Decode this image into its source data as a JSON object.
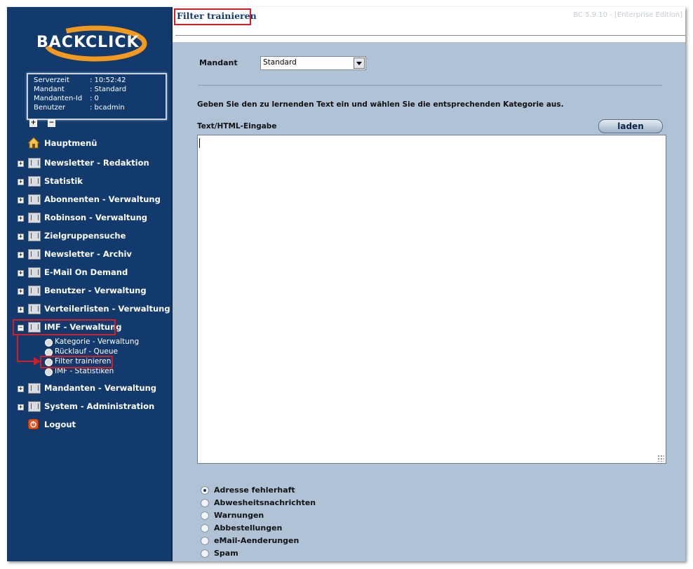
{
  "brand": {
    "logo_text": "BACKCLICK"
  },
  "server_info": [
    {
      "key": "Serverzeit",
      "value": ": 10:52:42"
    },
    {
      "key": "Mandant",
      "value": ": Standard"
    },
    {
      "key": "Mandanten-Id",
      "value": ": 0"
    },
    {
      "key": "Benutzer",
      "value": ": bcadmin"
    }
  ],
  "tree_controls": {
    "expand_all": "+",
    "collapse_all": "−"
  },
  "nav": {
    "items": [
      {
        "label": "Hauptmenü"
      },
      {
        "label": "Newsletter - Redaktion"
      },
      {
        "label": "Statistik"
      },
      {
        "label": "Abonnenten - Verwaltung"
      },
      {
        "label": "Robinson - Verwaltung"
      },
      {
        "label": "Zielgruppensuche"
      },
      {
        "label": "Newsletter - Archiv"
      },
      {
        "label": "E-Mail On Demand"
      },
      {
        "label": "Benutzer - Verwaltung"
      },
      {
        "label": "Verteilerlisten - Verwaltung"
      },
      {
        "label": "IMF - Verwaltung"
      },
      {
        "label": "Mandanten - Verwaltung"
      },
      {
        "label": "System - Administration"
      },
      {
        "label": "Logout"
      }
    ],
    "imf_sub": [
      {
        "label": "Kategorie - Verwaltung"
      },
      {
        "label": "Rücklauf - Queue"
      },
      {
        "label": "Filter trainieren"
      },
      {
        "label": "IMF - Statistiken"
      }
    ]
  },
  "header": {
    "page_title": "Filter trainieren",
    "version": "BC 5.9.10 - [Enterprise Edition]"
  },
  "form": {
    "mandant_label": "Mandant",
    "mandant_value": "Standard",
    "instruction": "Geben Sie den zu lernenden Text ein und wählen Sie die entsprechenden Kategorie aus.",
    "text_label": "Text/HTML-Eingabe",
    "load_button": "laden",
    "categories": [
      {
        "label": "Adresse fehlerhaft",
        "selected": true
      },
      {
        "label": "Abwesheitsnachrichten",
        "selected": false
      },
      {
        "label": "Warnungen",
        "selected": false
      },
      {
        "label": "Abbestellungen",
        "selected": false
      },
      {
        "label": "eMail-Aenderungen",
        "selected": false
      },
      {
        "label": "Spam",
        "selected": false
      }
    ]
  },
  "colors": {
    "sidebar": "#123a6d",
    "content": "#b0c2d6",
    "highlight": "#d11f2a"
  }
}
